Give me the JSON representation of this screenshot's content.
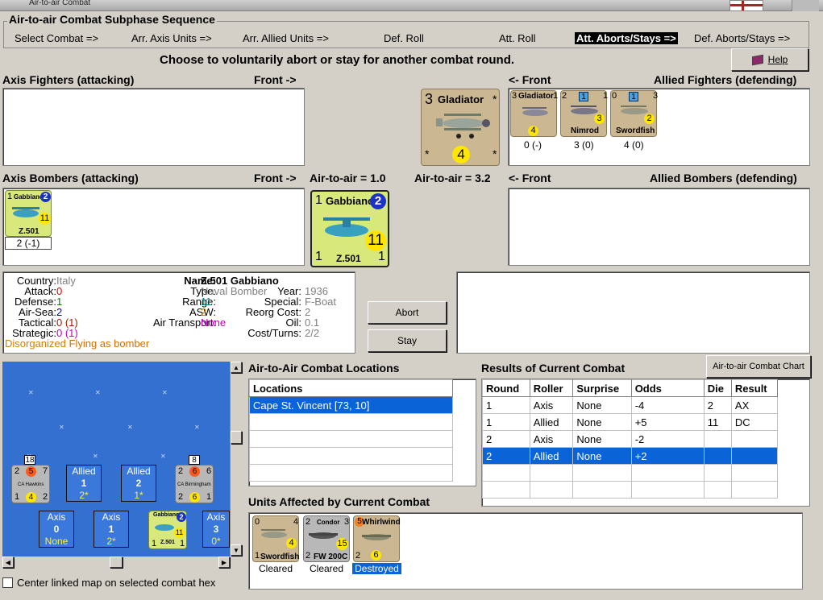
{
  "window": {
    "title": "Air-to-air Combat"
  },
  "sequence": {
    "title": "Air-to-air Combat Subphase Sequence",
    "steps": [
      "Select Combat =>",
      "Arr. Axis Units =>",
      "Arr. Allied Units =>",
      "Def. Roll",
      "Att. Roll",
      "Att. Aborts/Stays =>",
      "Def. Aborts/Stays =>"
    ],
    "active_index": 5
  },
  "prompt": "Choose to voluntarily abort or stay for another combat round.",
  "help_label": "Help",
  "labels": {
    "axis_fighters": "Axis Fighters (attacking)",
    "front_right_1": "Front ->",
    "front_left_1": "<- Front",
    "allied_fighters": "Allied Fighters (defending)",
    "axis_bombers": "Axis Bombers (attacking)",
    "front_right_2": "Front ->",
    "air_to_air_left": "Air-to-air = 1.0",
    "air_to_air_right": "Air-to-air = 3.2",
    "front_left_2": "<- Front",
    "allied_bombers": "Allied Bombers (defending)"
  },
  "big_allied_counter": {
    "name": "Gladiator",
    "top_left": "3",
    "value": "4",
    "corner": "*"
  },
  "big_axis_counter": {
    "name": "Gabbiano",
    "top_left": "1",
    "badge": "2",
    "value": "11",
    "bottom_left": "1",
    "bottom_name": "Z.501",
    "bottom_right": "1"
  },
  "allied_fighters": [
    {
      "name": "Gladiator",
      "tl": "3",
      "tr": "1",
      "val": "4",
      "caption": "0 (-)"
    },
    {
      "name": "Nimrod",
      "tl": "2",
      "badge": "1",
      "tr": "1",
      "val": "3",
      "caption": "3 (0)"
    },
    {
      "name": "Swordfish",
      "tl": "0",
      "badge": "1",
      "tr": "3",
      "val": "2",
      "caption": "4 (0)"
    }
  ],
  "axis_bombers": [
    {
      "name": "Gabbiano",
      "tl": "1",
      "badge": "2",
      "val": "11",
      "bottom": "Z.501",
      "caption": "2 (-1)"
    }
  ],
  "unit_info": {
    "country_label": "Country:",
    "country": "Italy",
    "attack_label": "Attack:",
    "attack": "0",
    "defense_label": "Defense:",
    "defense": "1",
    "airsea_label": "Air-Sea:",
    "airsea": "2",
    "tactical_label": "Tactical:",
    "tactical": "0 (1)",
    "strategic_label": "Strategic:",
    "strategic": "0 (1)",
    "status_a": "Disorganized",
    "status_b": "Flying as bomber",
    "name_label": "Name:",
    "name": "Z.501 Gabbiano",
    "type_label": "Type:",
    "type": "Naval Bomber",
    "year_label": "Year:",
    "year": "1936",
    "range_label": "Range:",
    "range": "11",
    "special_label": "Special:",
    "special": "F-Boat",
    "asw_label": "ASW:",
    "asw": "2",
    "reorg_label": "Reorg Cost:",
    "reorg": "2",
    "transport_label": "Air Transport:",
    "transport": "None",
    "oil_label": "Oil:",
    "oil": "0.1",
    "cost_label": "Cost/Turns:",
    "cost": "2/2"
  },
  "buttons": {
    "abort": "Abort",
    "stay": "Stay",
    "chart": "Air-to-air Combat Chart"
  },
  "colors": {
    "selection": "#0a64d8",
    "value_red": "#e00000",
    "value_green": "#008000",
    "value_blue": "#0000c0",
    "value_orange": "#d08000",
    "value_purple": "#c000c0",
    "value_gray": "#808080"
  },
  "locations": {
    "title": "Air-to-Air Combat Locations",
    "header": "Locations",
    "rows": [
      "Cape St. Vincent [73, 10]"
    ]
  },
  "results": {
    "title": "Results of Current Combat",
    "headers": [
      "Round",
      "Roller",
      "Surprise",
      "Odds",
      "Die",
      "Result"
    ],
    "rows": [
      [
        "1",
        "Axis",
        "None",
        "-4",
        "2",
        "AX"
      ],
      [
        "1",
        "Allied",
        "None",
        "+5",
        "11",
        "DC"
      ],
      [
        "2",
        "Axis",
        "None",
        "-2",
        "",
        ""
      ],
      [
        "2",
        "Allied",
        "None",
        "+2",
        "",
        ""
      ]
    ],
    "selected_row": 3
  },
  "affected": {
    "title": "Units Affected by Current Combat",
    "units": [
      {
        "name": "Swordfish",
        "tl": "0",
        "tr": "4",
        "val": "4",
        "bl": "1",
        "caption": "Cleared"
      },
      {
        "name": "FW 200C",
        "top": "Condor",
        "tl": "2",
        "tr": "3",
        "val": "15",
        "bl": "2",
        "caption": "Cleared"
      },
      {
        "name": "Whirlwind",
        "tl": "5",
        "val": "6",
        "bl": "2",
        "caption": "Destroyed"
      }
    ]
  },
  "map": {
    "hex_boxes": [
      {
        "title": "Allied",
        "num": "1",
        "sub": "2*"
      },
      {
        "title": "Allied",
        "num": "2",
        "sub": "1*"
      },
      {
        "title": "Axis",
        "num": "0",
        "sub": "None"
      },
      {
        "title": "Axis",
        "num": "1",
        "sub": "2*"
      },
      {
        "title": "Axis",
        "num": "3",
        "sub": "0*"
      }
    ],
    "ships": [
      {
        "stack": "18",
        "tl": "2",
        "orange": "5",
        "tr": "7",
        "name": "CA Hawkins",
        "bl": "1",
        "val": "4",
        "br": "2"
      },
      {
        "stack": "8",
        "tl": "2",
        "orange": "6",
        "tr": "6",
        "name": "CA Birmingham",
        "bl": "2",
        "val": "6",
        "br": "1"
      }
    ],
    "map_counter": {
      "name": "Gabbiano",
      "badge": "2",
      "val": "11",
      "bl": "1",
      "bottom": "Z.501",
      "br": "1"
    }
  },
  "center_checkbox": "Center linked map on selected combat hex"
}
